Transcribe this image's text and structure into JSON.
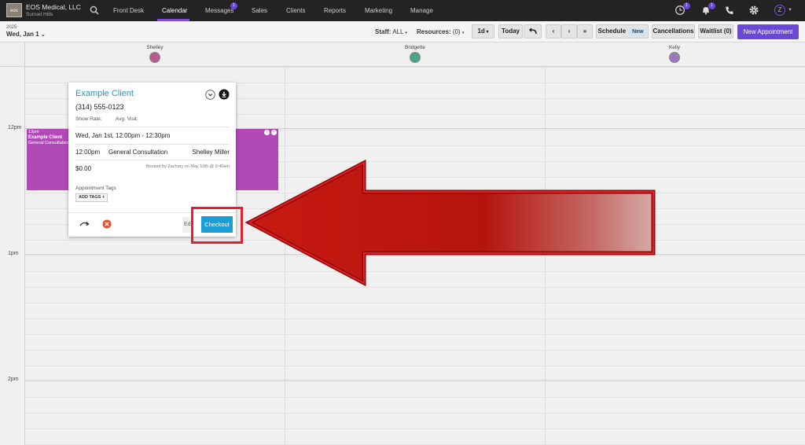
{
  "nav": {
    "company_name": "EOS Medical, LLC",
    "company_location": "Sunset Hills",
    "logo_text": "eos",
    "items": [
      {
        "label": "Front Desk"
      },
      {
        "label": "Calendar"
      },
      {
        "label": "Messages"
      },
      {
        "label": "Sales"
      },
      {
        "label": "Clients"
      },
      {
        "label": "Reports"
      },
      {
        "label": "Marketing"
      },
      {
        "label": "Manage"
      }
    ],
    "active_item": "Calendar",
    "messages_badge": "1",
    "clock_badge": "1",
    "bell_badge": "1",
    "avatar_initial": "Z",
    "accent_color": "#6b47d6",
    "icons": [
      "search-icon",
      "clock-icon",
      "bell-icon",
      "phone-icon",
      "gear-icon"
    ]
  },
  "toolbar": {
    "year": "2025",
    "date": "Wed, Jan 1",
    "staff_label": "Staff:",
    "staff_value": "ALL",
    "resources_label": "Resources:",
    "resources_value": "(0)",
    "view": "1d",
    "today": "Today",
    "schedule": "Schedule",
    "schedule_badge": "New",
    "cancellations": "Cancellations",
    "waitlist": "Waitlist (0)",
    "new_appointment": "New Appointment"
  },
  "staff": [
    {
      "name": "Shelley"
    },
    {
      "name": "Bridgette"
    },
    {
      "name": "Kelly"
    }
  ],
  "times": {
    "t12": "12pm",
    "t1": "1pm",
    "t2": "2pm"
  },
  "appointment": {
    "time": "12pm",
    "client": "Example Client",
    "service": "General Consultation",
    "color": "#b14ab7"
  },
  "popup": {
    "client_name": "Example Client",
    "phone": "(314) 555-0123",
    "show_rate_label": "Show Rate:",
    "avg_visit_label": "Avg. Visit:",
    "date_time": "Wed, Jan 1st, 12:00pm - 12:30pm",
    "start_time": "12:00pm",
    "service": "General Consultation",
    "staff": "Shelley Miller",
    "price": "$0.00",
    "booked_by": "Booked by Zachary on May 10th @ 9:40am",
    "tags_label": "Appointment Tags",
    "add_tags": "ADD TAGS +",
    "edit": "Edit",
    "checkout": "Checkout"
  },
  "annotation": {
    "highlight_color": "#e0202a",
    "arrow_color": "#c81a12"
  }
}
